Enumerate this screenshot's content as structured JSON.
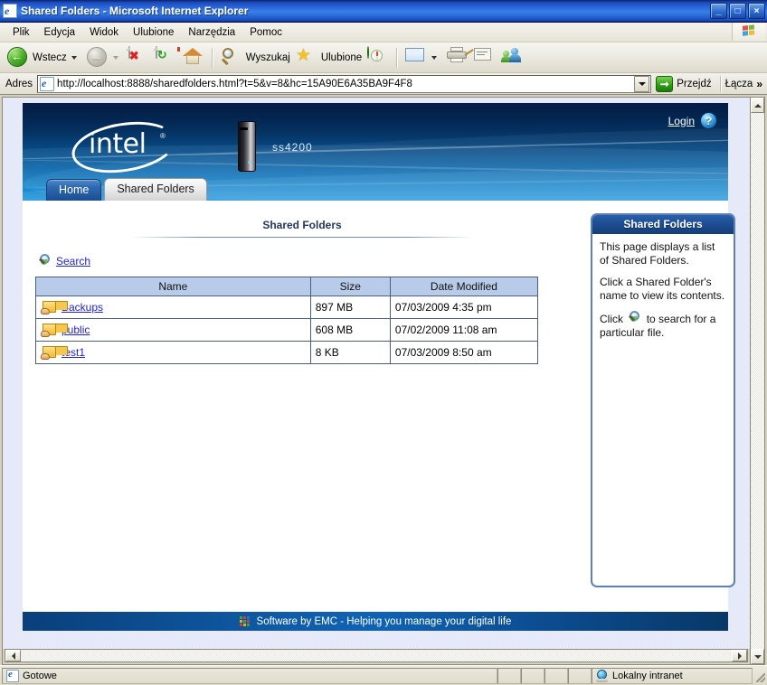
{
  "window": {
    "title": "Shared Folders - Microsoft Internet Explorer",
    "icon": "ie-document-icon",
    "minimize_label": "_",
    "maximize_label": "□",
    "close_label": "×"
  },
  "menu": {
    "items": [
      {
        "label": "Plik",
        "accel": "P"
      },
      {
        "label": "Edycja",
        "accel": "E"
      },
      {
        "label": "Widok",
        "accel": "W"
      },
      {
        "label": "Ulubione",
        "accel": "U"
      },
      {
        "label": "Narzędzia",
        "accel": "N"
      },
      {
        "label": "Pomoc",
        "accel": "c"
      }
    ],
    "brand_icon": "windows-flag-icon"
  },
  "toolbar": {
    "back_label": "Wstecz",
    "back_icon": "back-arrow-icon",
    "forward_icon": "forward-arrow-icon",
    "stop_icon": "stop-icon",
    "refresh_icon": "refresh-icon",
    "home_icon": "home-icon",
    "search_label": "Wyszukaj",
    "search_icon": "search-magnifier-icon",
    "favorites_label": "Ulubione",
    "favorites_icon": "star-icon",
    "history_icon": "history-compass-icon",
    "mail_icon": "mail-icon",
    "print_icon": "printer-icon",
    "edit_icon": "edit-page-icon",
    "messenger_icon": "messenger-people-icon"
  },
  "address": {
    "label": "Adres",
    "value": "http://localhost:8888/sharedfolders.html?t=5&v=8&hc=15A90E6A35BA9F4F8",
    "favicon": "ie-page-icon",
    "dropdown_icon": "chevron-down-icon",
    "go_label": "Przejdź",
    "go_icon": "go-arrow-icon",
    "links_label": "Łącza",
    "overflow_icon": "double-chevron-icon"
  },
  "banner": {
    "logo_text": "intel",
    "logo_trademark": "®",
    "device_icon": "nas-device-icon",
    "device_name": "ss4200",
    "login_label": "Login",
    "help_icon": "help-question-icon"
  },
  "tabs": [
    {
      "label": "Home",
      "state": "inactive"
    },
    {
      "label": "Shared Folders",
      "state": "active"
    }
  ],
  "main": {
    "heading": "Shared Folders",
    "search": {
      "label": "Search",
      "icon": "search-magnifier-icon"
    },
    "table": {
      "columns": [
        "Name",
        "Size",
        "Date Modified"
      ],
      "rows": [
        {
          "icon": "shared-folder-icon",
          "name": "Backups",
          "size": "897 MB",
          "modified": "07/03/2009 4:35 pm"
        },
        {
          "icon": "shared-folder-icon",
          "name": "public",
          "size": "608 MB",
          "modified": "07/02/2009 11:08 am"
        },
        {
          "icon": "shared-folder-icon",
          "name": "test1",
          "size": "8 KB",
          "modified": "07/03/2009 8:50 am"
        }
      ]
    }
  },
  "help_panel": {
    "title": "Shared Folders",
    "paragraph1": "This page displays a list of Shared Folders.",
    "paragraph2": "Click a Shared Folder's name to view its contents.",
    "paragraph3_before": "Click",
    "paragraph3_after": "to search for a particular file.",
    "inline_icon": "search-magnifier-icon"
  },
  "footer": {
    "logo_icon": "emc-blocks-icon",
    "text": "Software by EMC - Helping you manage your digital life"
  },
  "statusbar": {
    "status_text": "Gotowe",
    "status_icon": "ie-page-icon",
    "zone_text": "Lokalny intranet",
    "zone_icon": "globe-icon"
  },
  "scrollbars": {
    "up_icon": "scroll-up-icon",
    "down_icon": "scroll-down-icon",
    "left_icon": "scroll-left-icon",
    "right_icon": "scroll-right-icon"
  },
  "colors": {
    "titlebar_blue": "#0a246a",
    "banner_dark": "#031c44",
    "banner_light": "#2a9ade",
    "table_header": "#b8cbe8",
    "link_blue": "#2222cc",
    "page_bg": "#e6eaf8",
    "help_border": "#5b7fb9"
  }
}
